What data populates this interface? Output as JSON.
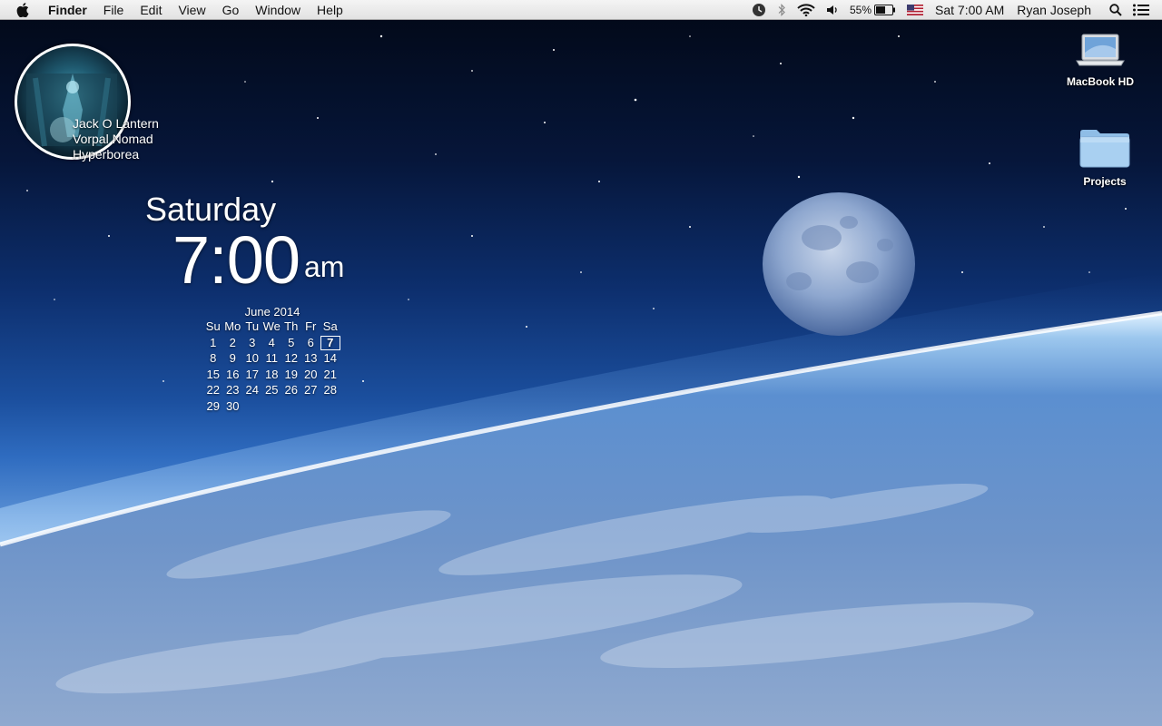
{
  "menubar": {
    "app_name": "Finder",
    "menus": [
      "File",
      "Edit",
      "View",
      "Go",
      "Window",
      "Help"
    ],
    "status": {
      "icons": [
        "time-machine-icon",
        "bluetooth-icon",
        "wifi-icon",
        "volume-icon"
      ],
      "battery_percent": "55%",
      "input_source": "us-flag-icon",
      "clock": "Sat 7:00 AM",
      "user": "Ryan Joseph"
    }
  },
  "now_playing": {
    "track": "Jack O Lantern",
    "artist": "Vorpal Nomad",
    "album": "Hyperborea",
    "album_art_text": "Vorpal Nomad"
  },
  "clock_widget": {
    "day": "Saturday",
    "time": "7:00",
    "ampm": "am"
  },
  "calendar": {
    "title": "June 2014",
    "weekdays": [
      "Su",
      "Mo",
      "Tu",
      "We",
      "Th",
      "Fr",
      "Sa"
    ],
    "first_weekday_index": 0,
    "days_in_month": 30,
    "today": 7
  },
  "desktop_icons": {
    "macbook": {
      "label": "MacBook HD",
      "icon": "laptop-drive-icon"
    },
    "projects": {
      "label": "Projects",
      "icon": "folder-icon"
    }
  },
  "colors": {
    "menubar_bg": "#e8e8e8",
    "sky_dark": "#020816",
    "atmosphere": "#cfe6ff",
    "moon": "#9fb7dc"
  }
}
